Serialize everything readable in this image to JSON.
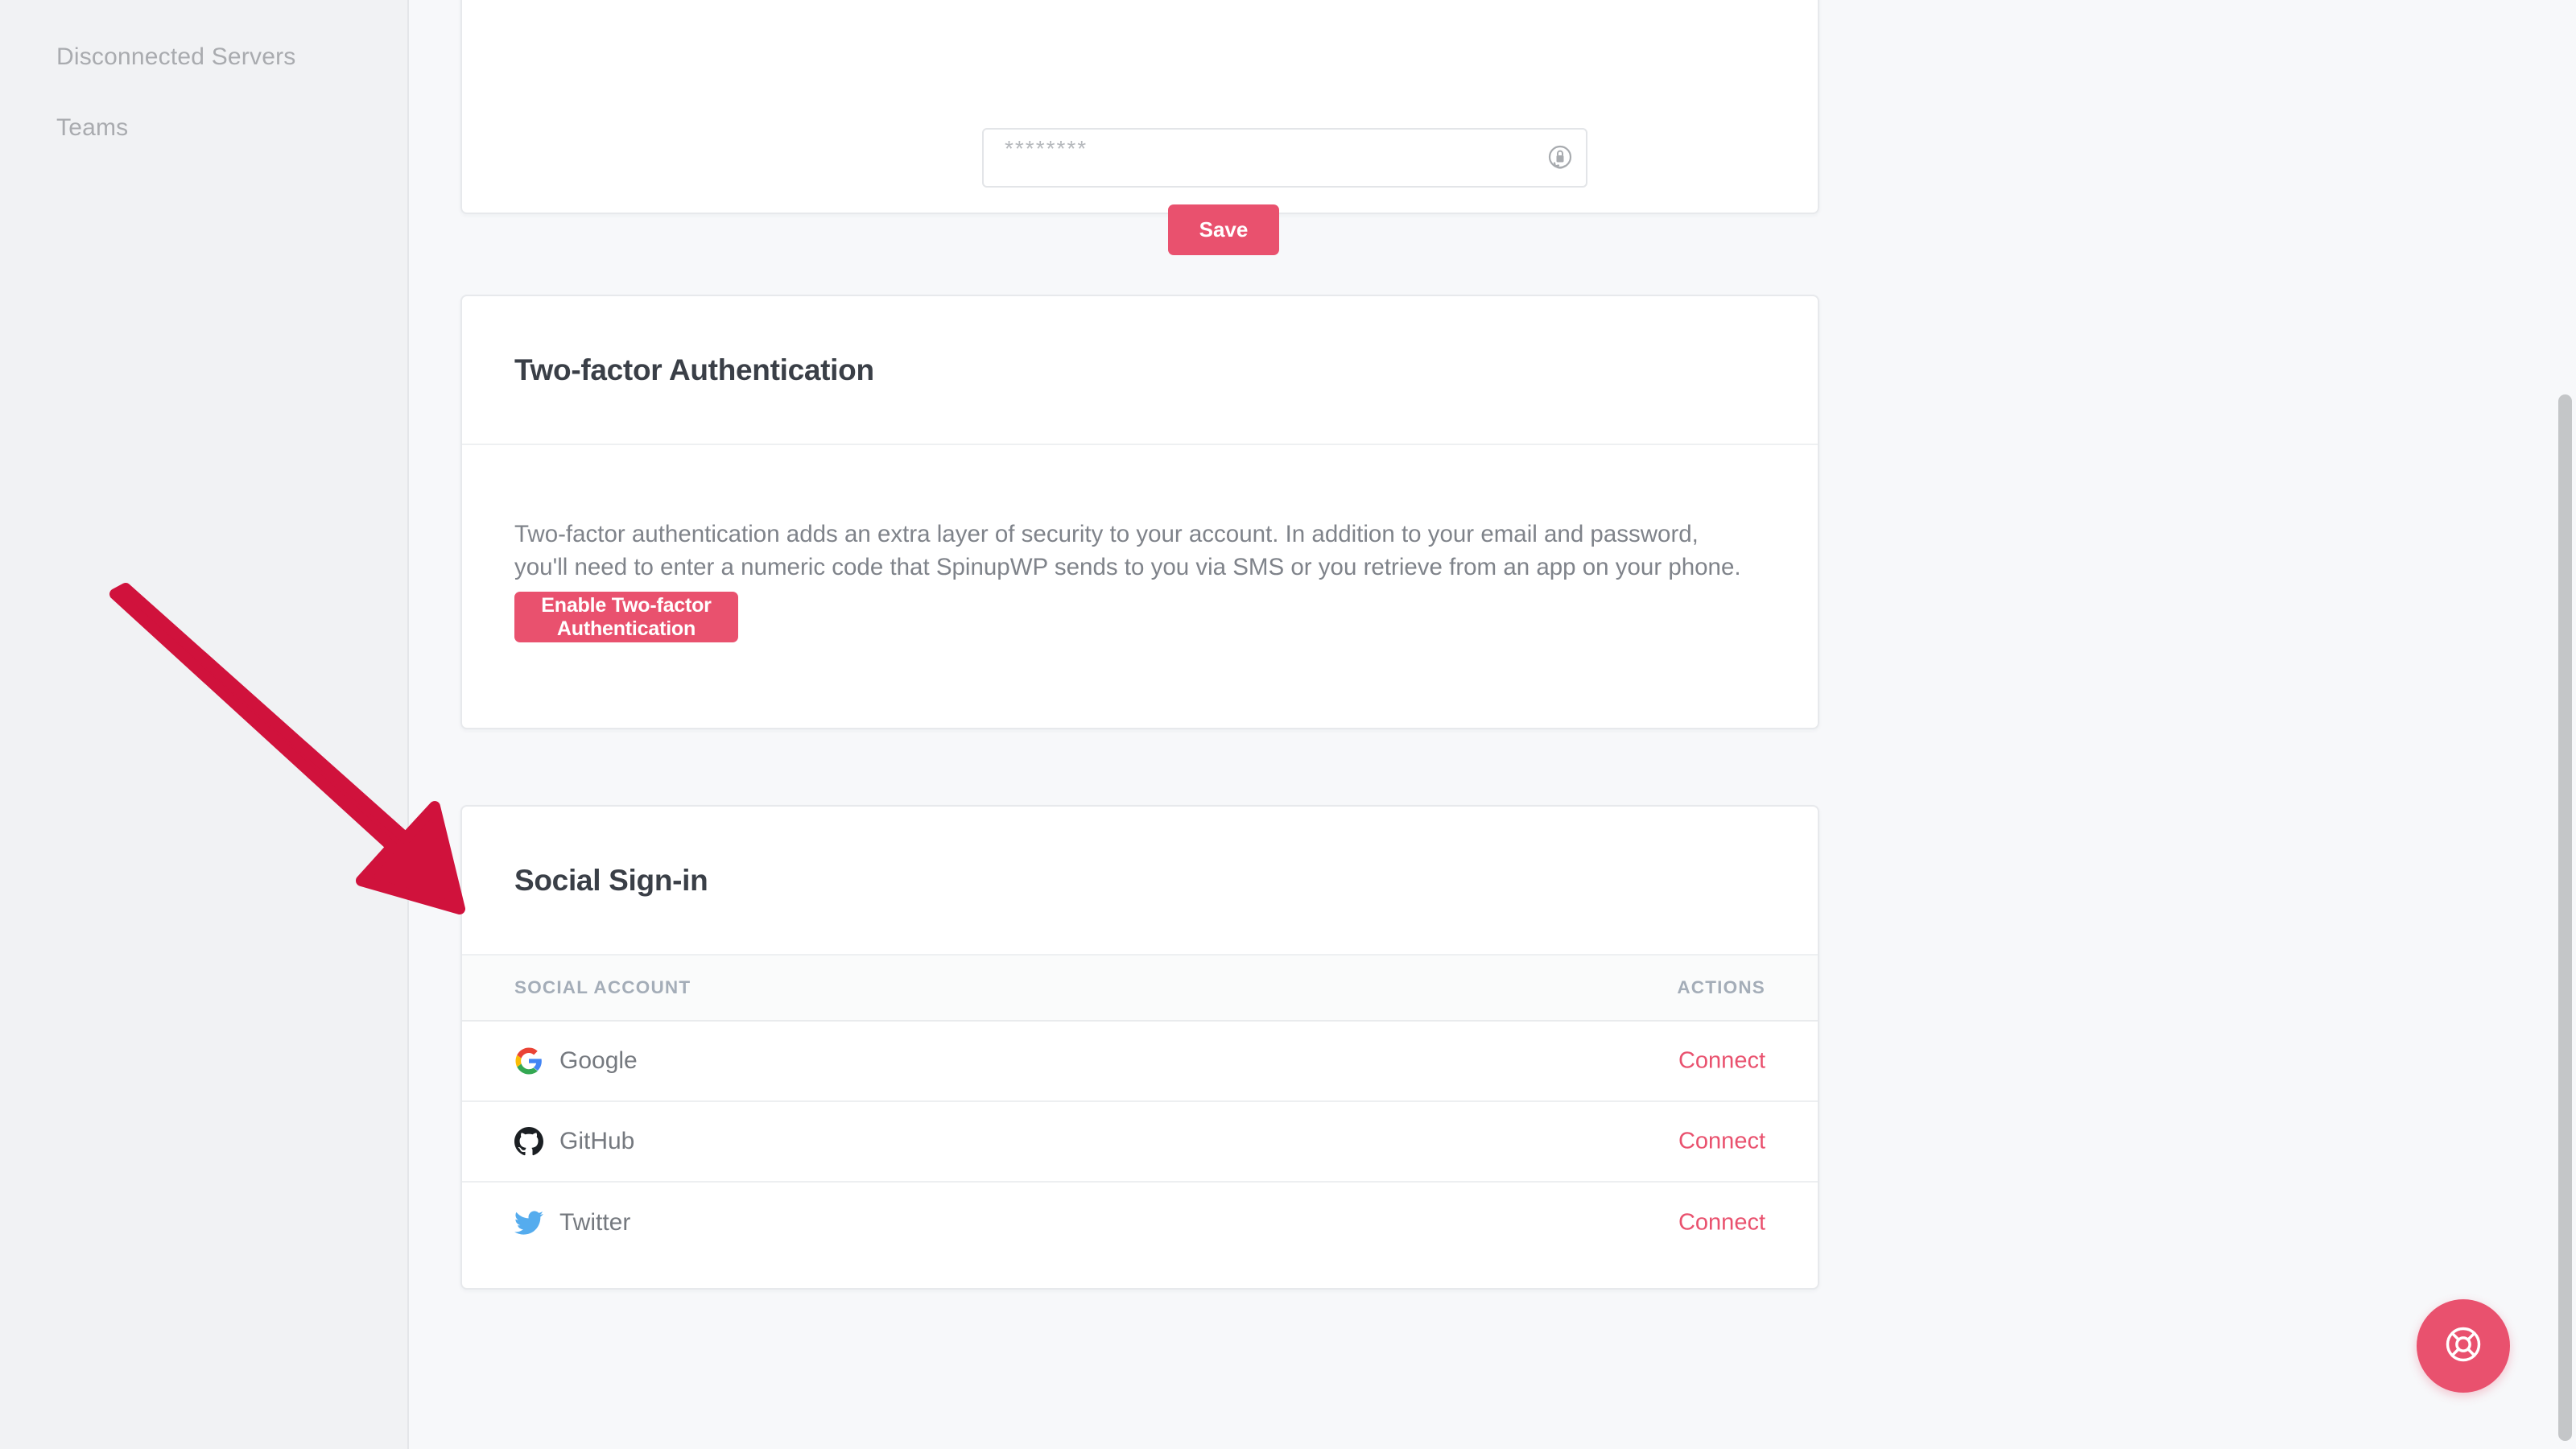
{
  "sidebar": {
    "items": [
      {
        "label": "Disconnected Servers"
      },
      {
        "label": "Teams"
      }
    ]
  },
  "password_card": {
    "input": {
      "value": "********",
      "placeholder": "********"
    },
    "lock_icon": "password-lock-icon",
    "save_label": "Save"
  },
  "two_factor_card": {
    "title": "Two-factor Authentication",
    "description": "Two-factor authentication adds an extra layer of security to your account. In addition to your email and password, you'll need to enter a numeric code that SpinupWP sends to you via SMS or you retrieve from an app on your phone.",
    "enable_label": "Enable Two-factor Authentication"
  },
  "social_card": {
    "title": "Social Sign-in",
    "columns": {
      "account": "SOCIAL ACCOUNT",
      "actions": "ACTIONS"
    },
    "rows": [
      {
        "icon": "google-icon",
        "label": "Google",
        "action": "Connect"
      },
      {
        "icon": "github-icon",
        "label": "GitHub",
        "action": "Connect"
      },
      {
        "icon": "twitter-icon",
        "label": "Twitter",
        "action": "Connect"
      }
    ]
  },
  "support": {
    "icon": "lifebuoy-icon"
  },
  "annotation": {
    "icon": "red-arrow-annotation",
    "color": "#d0123c"
  },
  "colors": {
    "accent": "#e9516e",
    "annotation_red": "#d0123c",
    "sidebar_bg": "#f1f2f4",
    "page_bg": "#f7f8fa",
    "card_bg": "#ffffff",
    "muted_text": "#7f838a",
    "heading_text": "#3a3f47",
    "table_header_text": "#a4adb8"
  },
  "scrollbar": {
    "name": "vertical-scrollbar"
  }
}
